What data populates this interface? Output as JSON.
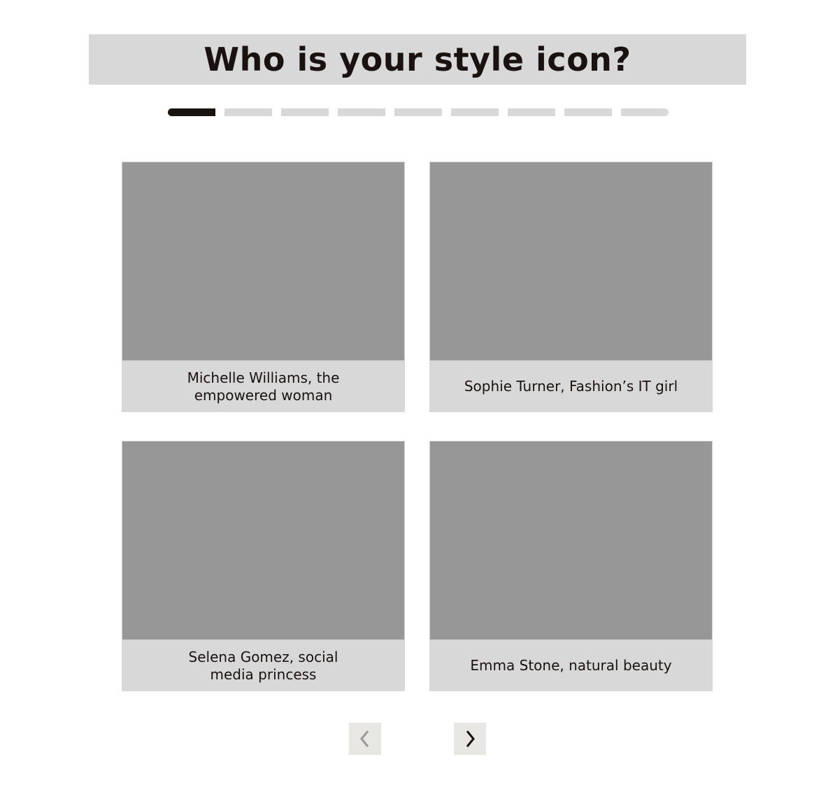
{
  "title": "Who is your style icon?",
  "progress": {
    "current": 1,
    "total": 9
  },
  "options": [
    {
      "label": "Michelle Williams, the empowered woman"
    },
    {
      "label": "Sophie Turner, Fashion’s IT girl"
    },
    {
      "label": "Selena Gomez, social media princess"
    },
    {
      "label": "Emma Stone, natural beauty"
    }
  ],
  "nav": {
    "prev_icon": "chevron-left-icon",
    "next_icon": "chevron-right-icon",
    "prev_glyph": "‹",
    "next_glyph": "›"
  },
  "colors": {
    "active": "#1a1210",
    "inactive": "#d8d8d8",
    "image_placeholder": "#979797"
  }
}
